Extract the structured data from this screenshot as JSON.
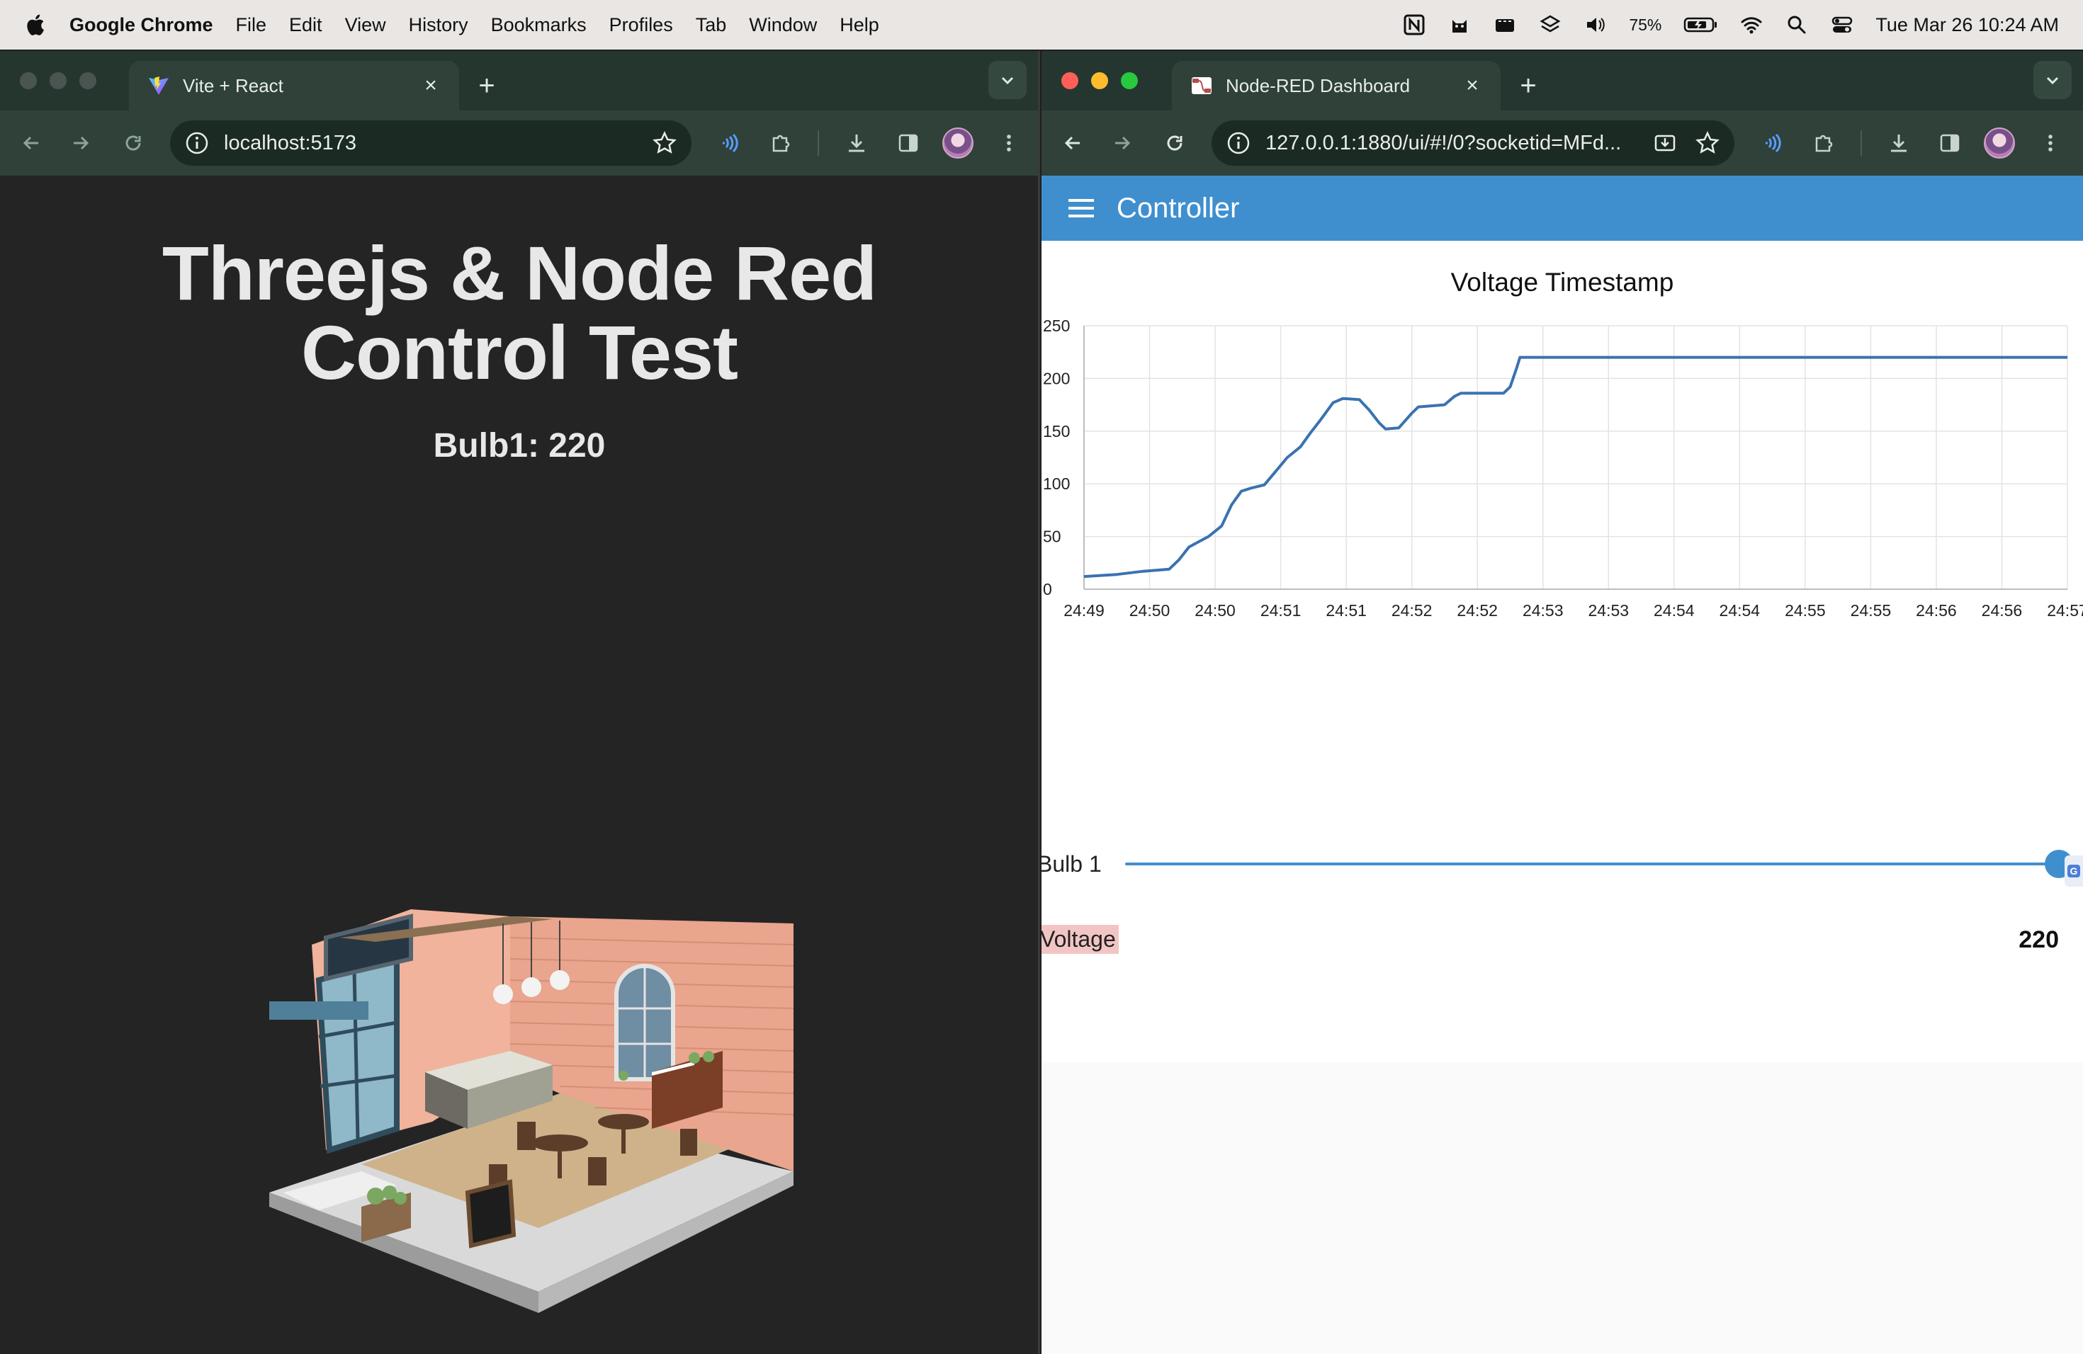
{
  "menubar": {
    "app_name": "Google Chrome",
    "items": [
      "File",
      "Edit",
      "View",
      "History",
      "Bookmarks",
      "Profiles",
      "Tab",
      "Window",
      "Help"
    ],
    "battery_percent": "75%",
    "clock": "Tue Mar 26  10:24 AM",
    "status_icons": [
      "notion-icon",
      "cat-icon",
      "clapper-icon",
      "layers-icon",
      "volume-icon",
      "battery-icon",
      "wifi-icon",
      "search-icon",
      "control-center-icon"
    ]
  },
  "left_browser": {
    "tab_title": "Vite + React",
    "url": "localhost:5173",
    "page": {
      "title": "Threejs & Node Red Control Test",
      "bulb_readout": "Bulb1: 220"
    }
  },
  "right_browser": {
    "tab_title": "Node-RED Dashboard",
    "url": "127.0.0.1:1880/ui/#!/0?socketid=MFd...",
    "dashboard": {
      "header_title": "Controller",
      "slider": {
        "label": "Bulb 1",
        "value": 220,
        "min": 0,
        "max": 220
      },
      "text_widget": {
        "label": "Voltage",
        "value": "220"
      },
      "side_widget_letter": "G"
    }
  },
  "chart_data": {
    "type": "line",
    "title": "Voltage Timestamp",
    "xlabel": "",
    "ylabel": "",
    "ylim": [
      0,
      250
    ],
    "yticks": [
      0,
      50,
      100,
      150,
      200,
      250
    ],
    "xticks": [
      "24:49",
      "24:50",
      "24:50",
      "24:51",
      "24:51",
      "24:52",
      "24:52",
      "24:53",
      "24:53",
      "24:54",
      "24:54",
      "24:55",
      "24:55",
      "24:56",
      "24:56",
      "24:57"
    ],
    "grid": true,
    "line_color": "#3a72b0",
    "series": [
      {
        "points": [
          [
            0.0,
            12
          ],
          [
            0.5,
            14
          ],
          [
            0.9,
            17
          ],
          [
            1.3,
            19
          ],
          [
            1.45,
            28
          ],
          [
            1.6,
            40
          ],
          [
            1.75,
            45
          ],
          [
            1.9,
            50
          ],
          [
            2.1,
            60
          ],
          [
            2.25,
            80
          ],
          [
            2.4,
            93
          ],
          [
            2.55,
            96
          ],
          [
            2.75,
            99
          ],
          [
            2.9,
            110
          ],
          [
            3.1,
            125
          ],
          [
            3.3,
            135
          ],
          [
            3.45,
            148
          ],
          [
            3.6,
            160
          ],
          [
            3.8,
            177
          ],
          [
            3.95,
            181
          ],
          [
            4.2,
            180
          ],
          [
            4.35,
            170
          ],
          [
            4.5,
            158
          ],
          [
            4.6,
            152
          ],
          [
            4.8,
            153
          ],
          [
            5.0,
            167
          ],
          [
            5.1,
            173
          ],
          [
            5.3,
            174
          ],
          [
            5.5,
            175
          ],
          [
            5.65,
            183
          ],
          [
            5.75,
            186
          ],
          [
            6.0,
            186
          ],
          [
            6.4,
            186
          ],
          [
            6.5,
            192
          ],
          [
            6.6,
            210
          ],
          [
            6.65,
            220
          ],
          [
            7.0,
            220
          ],
          [
            9.0,
            220
          ],
          [
            11.0,
            220
          ],
          [
            13.0,
            220
          ],
          [
            15.0,
            220
          ]
        ]
      }
    ]
  }
}
